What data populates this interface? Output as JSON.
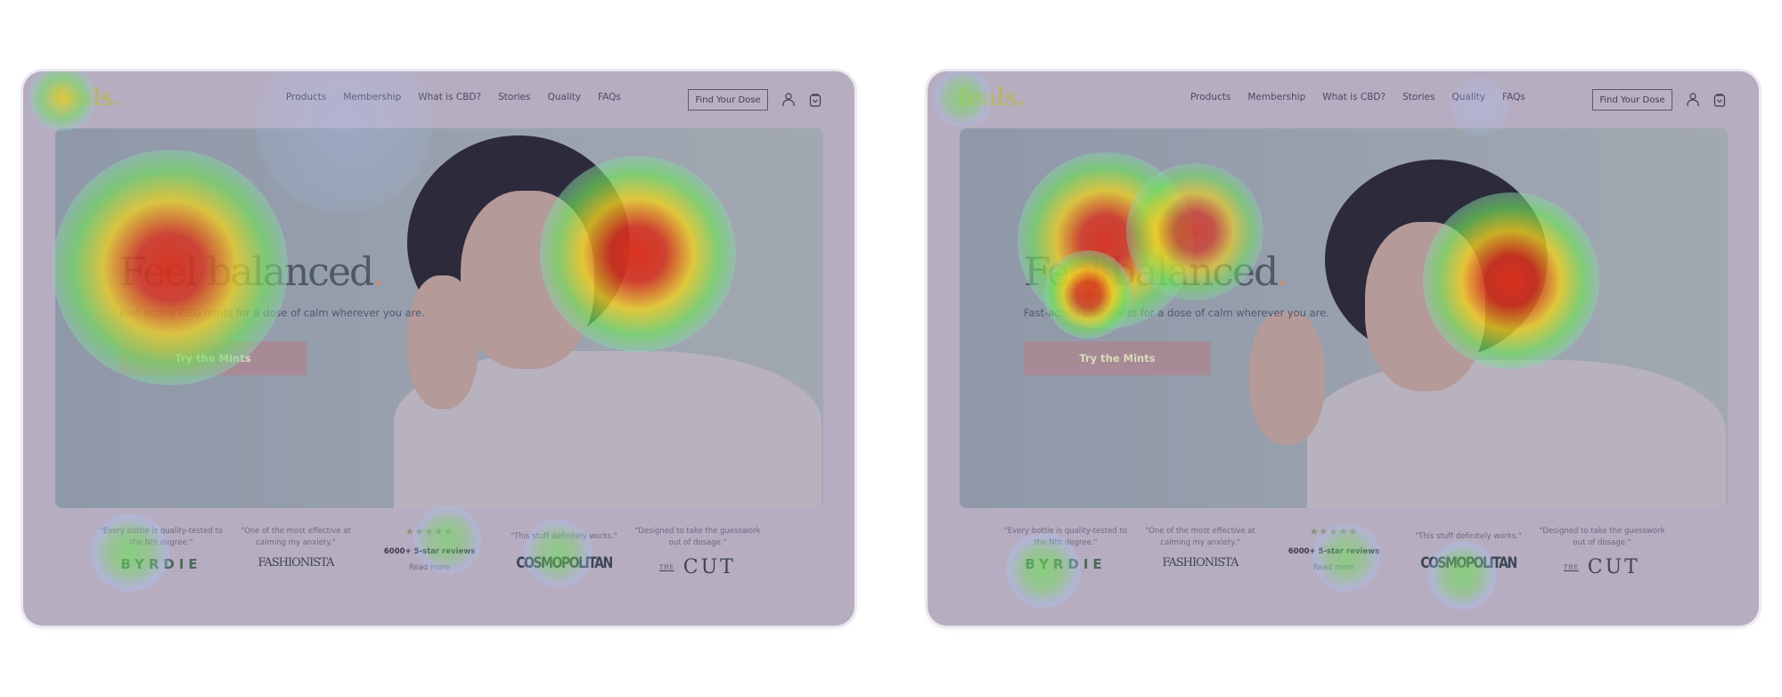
{
  "site": {
    "logo": "feals.",
    "nav": [
      "Products",
      "Membership",
      "What is CBD?",
      "Stories",
      "Quality",
      "FAQs"
    ],
    "cta_top": "Find Your Dose",
    "icons": {
      "account": "user-icon",
      "cart": "shopping-bag-icon"
    },
    "hero": {
      "headline": "Feel balanced",
      "headline_dot": ".",
      "subtitle": "Fast-acting CBD mints for a dose of calm wherever you are.",
      "button": "Try the Mints"
    },
    "press": [
      {
        "quote": "\"Every bottle is quality-tested to the Nth degree.\"",
        "brand": "BYRDIE"
      },
      {
        "quote": "\"One of the most effective at calming my anxiety.\"",
        "brand": "FASHIONISTA"
      },
      {
        "stars": "★★★★★",
        "reviews": "6000+ 5-star reviews",
        "link": "Read more"
      },
      {
        "quote": "\"This stuff definitely works.\"",
        "brand": "COSMOPOLITAN"
      },
      {
        "quote": "\"Designed to take the guesswork out of dosage.\"",
        "brand_prefix": "THE",
        "brand": "CUT"
      }
    ]
  },
  "heatmap_colors": {
    "hot": "#d8321e",
    "warm": "#f0d020",
    "mid": "#6fe05a",
    "cool": "#a9c4ff"
  }
}
